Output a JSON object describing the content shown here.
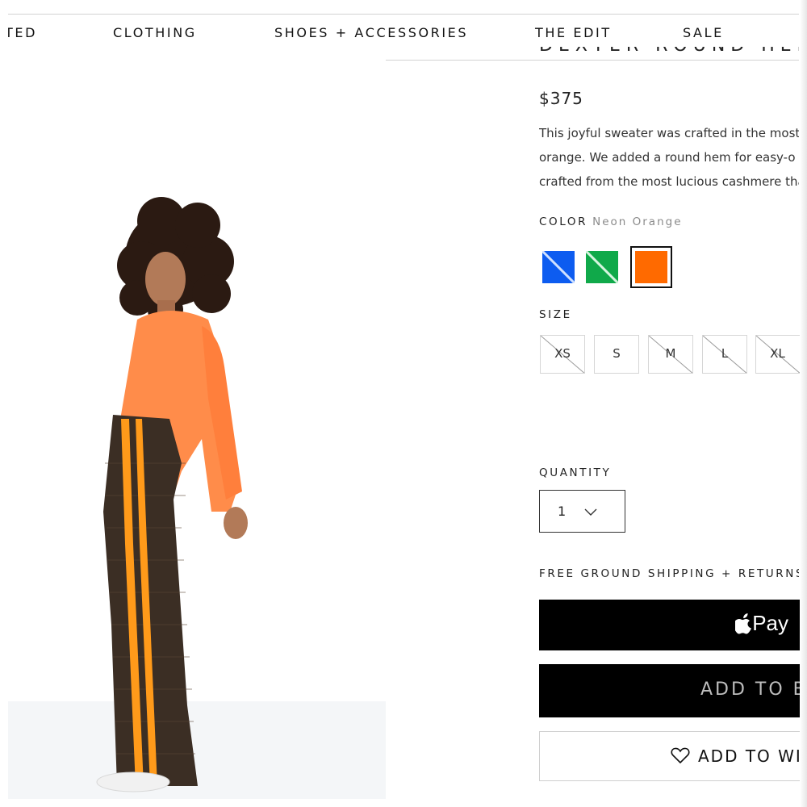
{
  "nav": {
    "items": [
      {
        "label": "TED"
      },
      {
        "label": "CLOTHING"
      },
      {
        "label": "SHOES + ACCESSORIES"
      },
      {
        "label": "THE EDIT"
      },
      {
        "label": "SALE"
      }
    ]
  },
  "product": {
    "title_fragment": "DEXTER ROUND HEM",
    "price": "$375",
    "description_lines": [
      "This joyful sweater was crafted in the most s",
      "orange. We added a round hem for easy-o",
      "crafted from the most lucious cashmere that"
    ]
  },
  "color": {
    "label": "COLOR",
    "selected_value": "Neon Orange",
    "swatches": [
      {
        "name": "blue",
        "hex": "#0d5cf0",
        "available": false,
        "selected": false
      },
      {
        "name": "green",
        "hex": "#10a94a",
        "available": false,
        "selected": false
      },
      {
        "name": "orange",
        "hex": "#ff6a00",
        "available": true,
        "selected": true
      }
    ]
  },
  "size": {
    "label": "SIZE",
    "options": [
      {
        "label": "XS",
        "available": false
      },
      {
        "label": "S",
        "available": true
      },
      {
        "label": "M",
        "available": false
      },
      {
        "label": "L",
        "available": false
      },
      {
        "label": "XL",
        "available": false
      }
    ]
  },
  "quantity": {
    "label": "QUANTITY",
    "value": "1"
  },
  "shipping_text": "FREE GROUND SHIPPING + RETURNS",
  "buttons": {
    "apple_pay": "Pay",
    "add_to_bag": "ADD TO BAG",
    "add_to_wishlist": "ADD TO WISHLIST"
  },
  "colors": {
    "text": "#1a1a1a",
    "muted": "#8a8a8a",
    "button_bg": "#000000",
    "sweater": "#ff8c4a",
    "pants_stripe": "#ff9a1a"
  }
}
